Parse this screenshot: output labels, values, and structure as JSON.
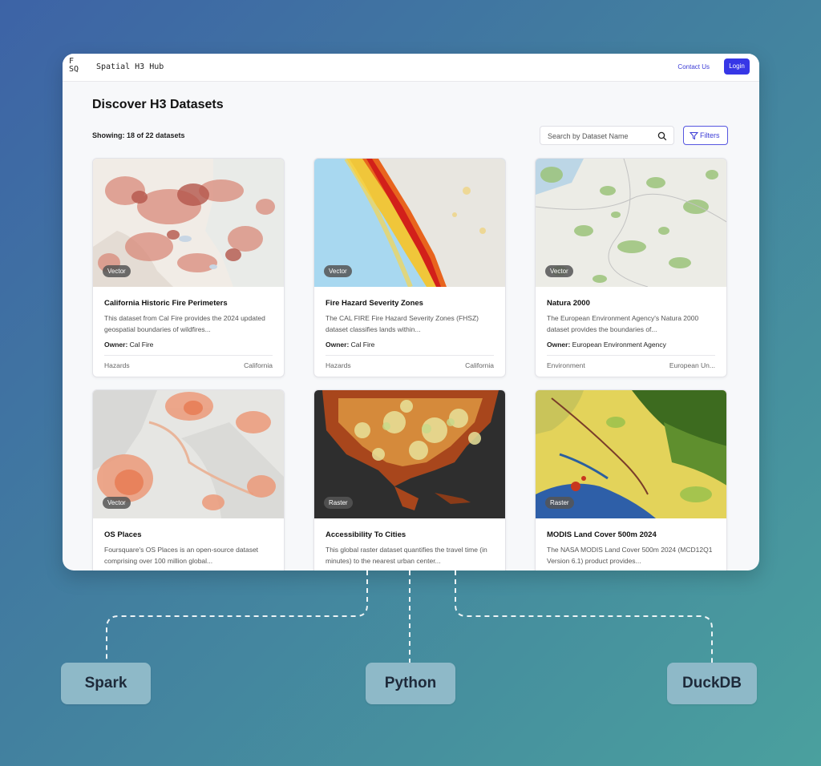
{
  "header": {
    "logo_line1": "F",
    "logo_line2": "SQ",
    "app_title": "Spatial H3 Hub",
    "contact_label": "Contact Us",
    "login_label": "Login"
  },
  "main": {
    "title": "Discover H3 Datasets",
    "showing": "Showing: 18 of 22 datasets",
    "search_placeholder": "Search by Dataset Name",
    "filters_label": "Filters"
  },
  "owner_label": "Owner:",
  "cards": [
    {
      "title": "California Historic Fire Perimeters",
      "desc": "This dataset from Cal Fire provides the 2024 updated geospatial boundaries of wildfires...",
      "owner": "Cal Fire",
      "category": "Hazards",
      "region": "California",
      "type": "Vector"
    },
    {
      "title": "Fire Hazard Severity Zones",
      "desc": "The CAL FIRE Fire Hazard Severity Zones (FHSZ) dataset classifies lands within...",
      "owner": "Cal Fire",
      "category": "Hazards",
      "region": "California",
      "type": "Vector"
    },
    {
      "title": "Natura 2000",
      "desc": "The European Environment Agency's Natura 2000 dataset provides the boundaries of...",
      "owner": "European Environment Agency",
      "category": "Environment",
      "region": "European Un...",
      "type": "Vector"
    },
    {
      "title": "OS Places",
      "desc": "Foursquare's OS Places is an open-source dataset comprising over 100 million global...",
      "type": "Vector"
    },
    {
      "title": "Accessibility To Cities",
      "desc": "This global raster dataset quantifies the travel time (in minutes) to the nearest urban center...",
      "type": "Raster"
    },
    {
      "title": "MODIS Land Cover 500m 2024",
      "desc": "The NASA MODIS Land Cover 500m 2024 (MCD12Q1 Version 6.1) product provides...",
      "type": "Raster"
    }
  ],
  "engines": [
    "Spark",
    "Python",
    "DuckDB"
  ],
  "colors": {
    "accent": "#3737e6",
    "pill": "#8eb9c8"
  }
}
